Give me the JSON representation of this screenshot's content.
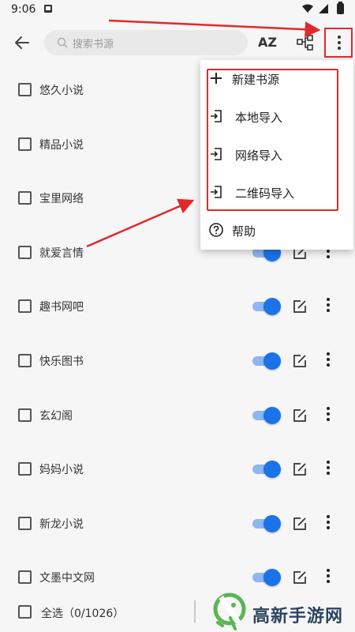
{
  "status_bar": {
    "time": "9:06"
  },
  "toolbar": {
    "search_placeholder": "搜索书源",
    "sort_label": "AZ"
  },
  "sources": [
    {
      "name": "悠久小说",
      "enabled": true
    },
    {
      "name": "精品小说",
      "enabled": true
    },
    {
      "name": "宝里网络",
      "enabled": true
    },
    {
      "name": "就爱言情",
      "enabled": true
    },
    {
      "name": "趣书网吧",
      "enabled": true
    },
    {
      "name": "快乐图书",
      "enabled": true
    },
    {
      "name": "玄幻阁",
      "enabled": true
    },
    {
      "name": "妈妈小说",
      "enabled": true
    },
    {
      "name": "新龙小说",
      "enabled": true
    },
    {
      "name": "文墨中文网",
      "enabled": true
    }
  ],
  "bottom_bar": {
    "select_all_label": "全选（0/1026）"
  },
  "menu": {
    "items": [
      {
        "label": "新建书源",
        "icon": "plus-icon"
      },
      {
        "label": "本地导入",
        "icon": "import-icon"
      },
      {
        "label": "网络导入",
        "icon": "import-icon"
      },
      {
        "label": "二维码导入",
        "icon": "import-icon"
      },
      {
        "label": "帮助",
        "icon": "help-circle-icon"
      }
    ]
  },
  "watermark": {
    "text": "高新手游网"
  },
  "colors": {
    "accent": "#1a73e8",
    "annotation": "#e02a2a"
  }
}
